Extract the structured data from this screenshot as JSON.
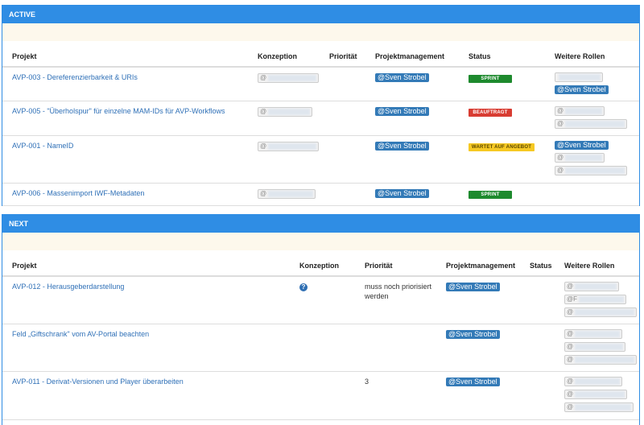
{
  "active": {
    "title": "ACTIVE",
    "columns": [
      "Projekt",
      "Konzeption",
      "Priorität",
      "Projektmanagement",
      "Status",
      "Weitere Rollen"
    ],
    "rows": [
      {
        "project": "AVP-003 - Dereferenzierbarkeit & URIs",
        "konzeption_prefix": "@",
        "pm": "@Sven Strobel",
        "status": "SPRINT",
        "status_kind": "sprint",
        "roles": [
          {
            "text": "",
            "blurred": true
          },
          {
            "text": "@Sven Strobel",
            "blurred": false
          }
        ]
      },
      {
        "project": "AVP-005 - \"Überholspur\" für einzelne MAM-IDs für AVP-Workflows",
        "konzeption_prefix": "@",
        "pm": "@Sven Strobel",
        "status": "BEAUFTRAGT",
        "status_kind": "beauftragt",
        "roles": [
          {
            "text": "@",
            "blurred": true
          },
          {
            "text": "@",
            "blurred": true
          }
        ]
      },
      {
        "project": "AVP-001 - NameID",
        "konzeption_prefix": "@",
        "pm": "@Sven Strobel",
        "status": "WARTET AUF ANGEBOT",
        "status_kind": "wartet",
        "roles": [
          {
            "text": "@Sven Strobel",
            "blurred": false
          },
          {
            "text": "@",
            "blurred": true
          },
          {
            "text": "@",
            "blurred": true
          }
        ]
      },
      {
        "project": "AVP-006 - Massenimport IWF-Metadaten",
        "konzeption_prefix": "@",
        "pm": "@Sven Strobel",
        "status": "SPRINT",
        "status_kind": "sprint",
        "roles": []
      }
    ]
  },
  "next": {
    "title": "NEXT",
    "columns": [
      "Projekt",
      "Konzeption",
      "Priorität",
      "Projektmanagement",
      "Status",
      "Weitere Rollen"
    ],
    "rows": [
      {
        "project": "AVP-012 - Herausgeberdarstellung",
        "konzeption_icon": "question-icon",
        "priority": "muss noch priorisiert werden",
        "pm": "@Sven Strobel",
        "roles": [
          {
            "text": "@"
          },
          {
            "text": "@F"
          },
          {
            "text": "@"
          }
        ]
      },
      {
        "project": "Feld „Giftschrank\" vom AV-Portal beachten",
        "priority": "",
        "pm": "@Sven Strobel",
        "roles": [
          {
            "text": "@"
          },
          {
            "text": "@"
          },
          {
            "text": "@"
          }
        ]
      },
      {
        "project": "AVP-011 - Derivat-Versionen und Player überarbeiten",
        "priority": "3",
        "pm": "@Sven Strobel",
        "roles": [
          {
            "text": "@"
          },
          {
            "text": "@"
          },
          {
            "text": "@"
          }
        ]
      }
    ]
  }
}
